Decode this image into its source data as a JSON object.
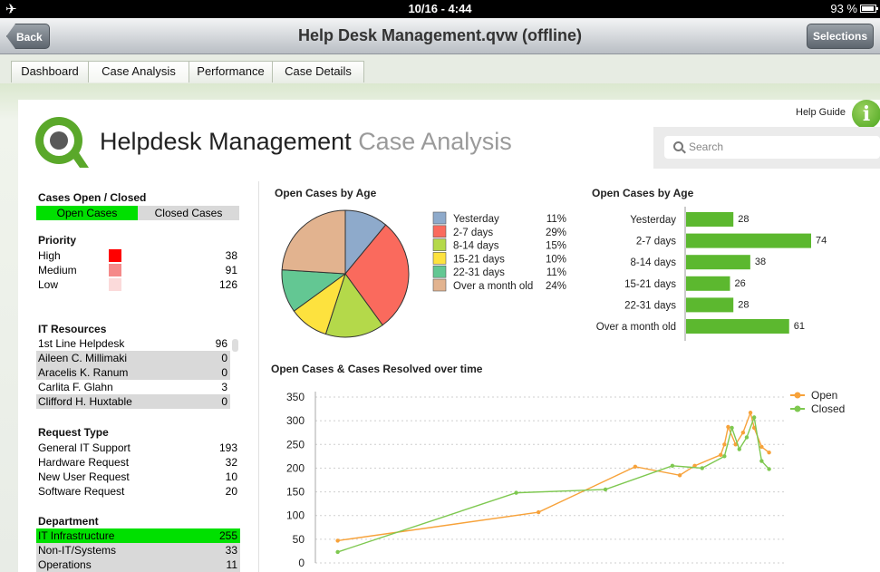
{
  "status": {
    "time": "10/16 - 4:44",
    "battery": "93 %"
  },
  "titlebar": {
    "title": "Help Desk Management.qvw (offline)",
    "back_label": "Back",
    "selections_label": "Selections"
  },
  "tabs": [
    {
      "label": "Dashboard"
    },
    {
      "label": "Case Analysis",
      "active": true
    },
    {
      "label": "Performance"
    },
    {
      "label": "Case Details"
    }
  ],
  "header": {
    "title": "Helpdesk Management",
    "subtitle": "Case Analysis",
    "help_label": "Help Guide",
    "search_placeholder": "Search"
  },
  "colors": {
    "selected": "#00e000",
    "excluded": "#d9d9d9",
    "bar": "#5cb82f",
    "open_line": "#f7a23a",
    "closed_line": "#7ec850"
  },
  "filters": {
    "open_closed": {
      "title": "Cases Open / Closed",
      "options": [
        "Open Cases",
        "Closed Cases"
      ],
      "selected": "Open Cases"
    },
    "priority": {
      "title": "Priority",
      "items": [
        {
          "label": "High",
          "value": "38",
          "swatch": "#ff0000"
        },
        {
          "label": "Medium",
          "value": "91",
          "swatch": "#f58a8a"
        },
        {
          "label": "Low",
          "value": "126",
          "swatch": "#fbdada"
        }
      ]
    },
    "it_resources": {
      "title": "IT Resources",
      "items": [
        {
          "label": "1st Line Helpdesk",
          "value": "96",
          "state": "normal"
        },
        {
          "label": "Aileen C. Millimaki",
          "value": "0",
          "state": "excluded"
        },
        {
          "label": "Aracelis K. Ranum",
          "value": "0",
          "state": "excluded"
        },
        {
          "label": "Carlita F. Glahn",
          "value": "3",
          "state": "normal"
        },
        {
          "label": "Clifford H. Huxtable",
          "value": "0",
          "state": "excluded"
        }
      ]
    },
    "request_type": {
      "title": "Request Type",
      "items": [
        {
          "label": "General IT Support",
          "value": "193"
        },
        {
          "label": "Hardware Request",
          "value": "32"
        },
        {
          "label": "New User Request",
          "value": "10"
        },
        {
          "label": "Software Request",
          "value": "20"
        }
      ]
    },
    "department": {
      "title": "Department",
      "items": [
        {
          "label": "IT Infrastructure",
          "value": "255",
          "state": "selected"
        },
        {
          "label": "Non-IT/Systems",
          "value": "33",
          "state": "excluded"
        },
        {
          "label": "Operations",
          "value": "11",
          "state": "excluded"
        }
      ]
    }
  },
  "chart_data": [
    {
      "type": "pie",
      "title": "Open Cases by Age",
      "categories": [
        "Yesterday",
        "2-7 days",
        "8-14 days",
        "15-21 days",
        "22-31 days",
        "Over a month old"
      ],
      "values": [
        11,
        29,
        15,
        10,
        11,
        24
      ],
      "labels": [
        "11%",
        "29%",
        "15%",
        "10%",
        "11%",
        "24%"
      ],
      "colors": [
        "#8eaacb",
        "#fa6a5d",
        "#b4d94a",
        "#fde23e",
        "#63c793",
        "#e2b38f"
      ],
      "legend": "right"
    },
    {
      "type": "bar",
      "orientation": "horizontal",
      "title": "Open Cases by Age",
      "categories": [
        "Yesterday",
        "2-7 days",
        "8-14 days",
        "15-21 days",
        "22-31 days",
        "Over a month old"
      ],
      "values": [
        28,
        74,
        38,
        26,
        28,
        61
      ],
      "labels": [
        "28",
        "74",
        "38",
        "26",
        "28",
        "61"
      ]
    },
    {
      "type": "line",
      "title": "Open Cases & Cases Resolved over time",
      "ylim": [
        0,
        350
      ],
      "yticks": [
        "0",
        "50",
        "100",
        "150",
        "200",
        "250",
        "300",
        "350"
      ],
      "grid": true,
      "legend": "top-right",
      "series": [
        {
          "name": "Open",
          "points": [
            [
              0.03,
              47
            ],
            [
              0.3,
              107
            ],
            [
              0.43,
              203
            ],
            [
              0.49,
              185
            ],
            [
              0.51,
              205
            ],
            [
              0.545,
              228
            ],
            [
              0.55,
              250
            ],
            [
              0.555,
              287
            ],
            [
              0.565,
              250
            ],
            [
              0.575,
              275
            ],
            [
              0.585,
              317
            ],
            [
              0.59,
              285
            ],
            [
              0.6,
              245
            ],
            [
              0.61,
              233
            ]
          ]
        },
        {
          "name": "Closed",
          "points": [
            [
              0.03,
              23
            ],
            [
              0.27,
              148
            ],
            [
              0.39,
              155
            ],
            [
              0.48,
              205
            ],
            [
              0.52,
              200
            ],
            [
              0.55,
              225
            ],
            [
              0.56,
              285
            ],
            [
              0.57,
              240
            ],
            [
              0.58,
              265
            ],
            [
              0.59,
              307
            ],
            [
              0.6,
              215
            ],
            [
              0.61,
              198
            ]
          ]
        }
      ]
    }
  ]
}
